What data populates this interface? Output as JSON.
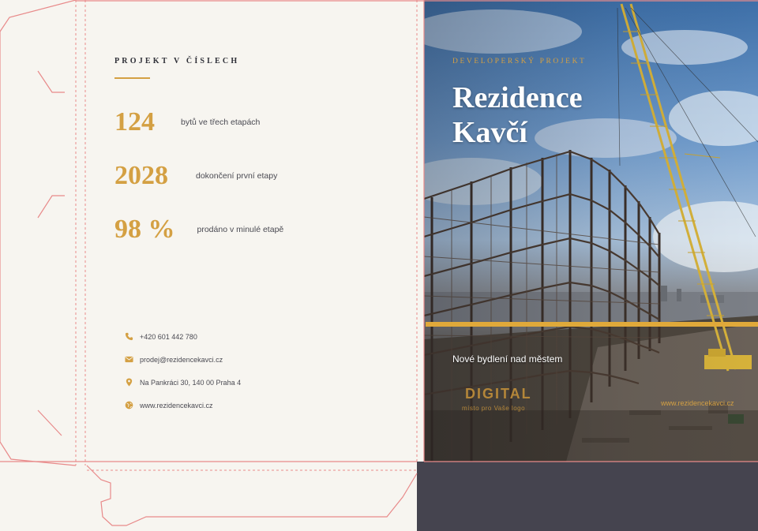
{
  "inside": {
    "section_title": "PROJEKT V ČÍSLECH",
    "stats": [
      {
        "number": "124",
        "label": "bytů ve třech etapách"
      },
      {
        "number": "2028",
        "label": "dokončení první etapy"
      },
      {
        "number": "98 %",
        "label": "prodáno v minulé etapě"
      }
    ],
    "contacts": [
      {
        "icon": "phone-icon",
        "text": "+420 601 442 780"
      },
      {
        "icon": "mail-icon",
        "text": "prodej@rezidencekavci.cz"
      },
      {
        "icon": "location-pin-icon",
        "text": "Na Pankráci 30, 140 00 Praha 4"
      },
      {
        "icon": "globe-icon",
        "text": "www.rezidencekavci.cz"
      }
    ]
  },
  "cover": {
    "kicker": "DEVELOPERSKÝ PROJEKT",
    "title_line1": "Rezidence",
    "title_line2": "Kavčí",
    "tagline": "Nové bydlení nad městem",
    "logo_word": "DIGITAL",
    "logo_sub": "místo pro Vaše logo",
    "url": "www.rezidencekavci.cz"
  },
  "colors": {
    "accent": "#d4a043",
    "dark_text": "#2f3038",
    "dieline": "#e88a8a",
    "panel_dark": "#45444f"
  }
}
